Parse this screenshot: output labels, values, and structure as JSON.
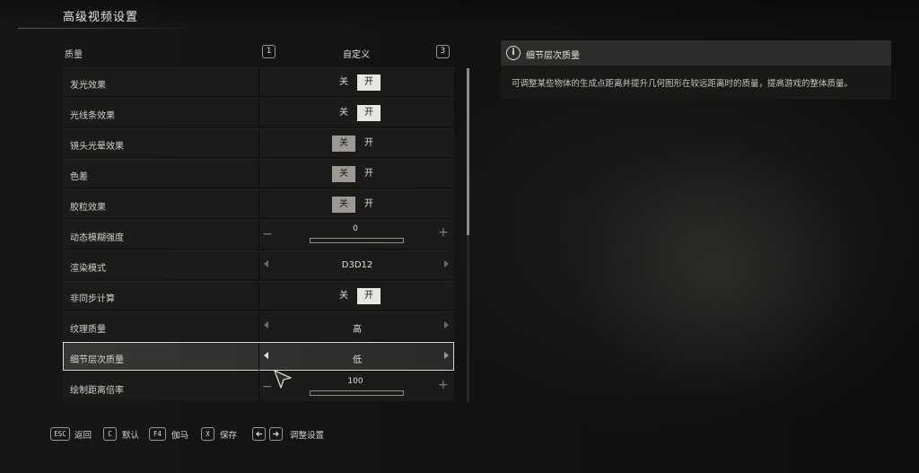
{
  "page": {
    "title": "高级视频设置"
  },
  "quality": {
    "label": "质量",
    "key_left": "1",
    "key_right": "3",
    "value": "自定义"
  },
  "settings": [
    {
      "label": "发光效果",
      "type": "toggle",
      "off": "关",
      "on": "开",
      "selected": "on"
    },
    {
      "label": "光线条效果",
      "type": "toggle",
      "off": "关",
      "on": "开",
      "selected": "on"
    },
    {
      "label": "镜头光晕效果",
      "type": "toggle",
      "off": "关",
      "on": "开",
      "selected": "off"
    },
    {
      "label": "色差",
      "type": "toggle",
      "off": "关",
      "on": "开",
      "selected": "off"
    },
    {
      "label": "胶粒效果",
      "type": "toggle",
      "off": "关",
      "on": "开",
      "selected": "off"
    },
    {
      "label": "动态模糊强度",
      "type": "slider",
      "value": "0",
      "minus": "−",
      "plus": "+",
      "fraction": 0
    },
    {
      "label": "渲染模式",
      "type": "selector",
      "value": "D3D12"
    },
    {
      "label": "非同步计算",
      "type": "toggle",
      "off": "关",
      "on": "开",
      "selected": "on"
    },
    {
      "label": "纹理质量",
      "type": "selector",
      "value": "高"
    },
    {
      "label": "细节层次质量",
      "type": "selector",
      "value": "低"
    },
    {
      "label": "绘制距离倍率",
      "type": "slider",
      "value": "100",
      "minus": "−",
      "plus": "+",
      "fraction": 0
    }
  ],
  "active_index": 9,
  "info": {
    "title": "细节层次质量",
    "icon": "i",
    "description": "可调整某些物体的生成点距离并提升几何图形在较远距离时的质量，提高游戏的整体质量。"
  },
  "footer": {
    "back_key": "ESC",
    "back_label": "返回",
    "default_key": "C",
    "default_label": "默认",
    "gamma_key": "F4",
    "gamma_label": "伽马",
    "save_key": "X",
    "save_label": "保存",
    "adjust_label": "调整设置"
  }
}
